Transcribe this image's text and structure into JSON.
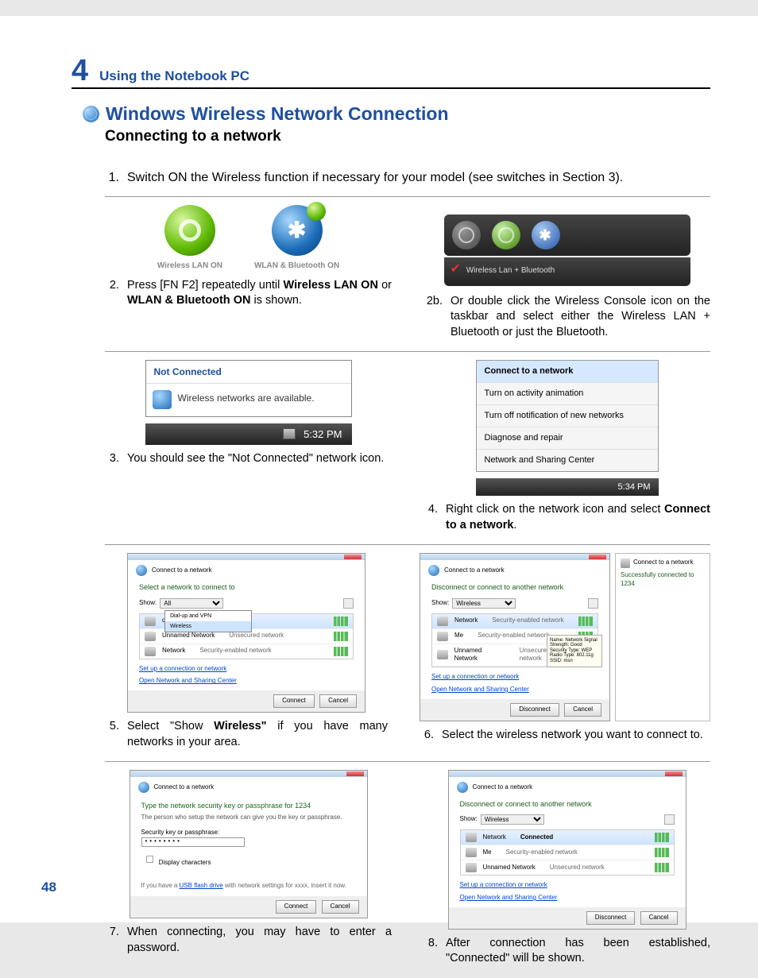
{
  "chapter": {
    "num": "4",
    "title": "Using the Notebook PC"
  },
  "section": {
    "title": "Windows Wireless Network Connection",
    "subtitle": "Connecting to a network"
  },
  "page_num": "48",
  "step1": {
    "num": "1.",
    "text": "Switch ON the Wireless function if necessary for your model (see switches in Section 3)."
  },
  "step2": {
    "num": "2.",
    "text_pre": "Press [FN F2] repeatedly until ",
    "bold1": "Wireless LAN ON",
    "mid": " or ",
    "bold2": "WLAN & Bluetooth ON",
    "text_post": " is shown.",
    "osd_wlan": "Wireless LAN ON",
    "osd_both": "WLAN & Bluetooth ON"
  },
  "step2b": {
    "num": "2b.",
    "text": "Or double click the Wireless Console icon on the taskbar and select either the Wireless LAN + Bluetooth or just the Bluetooth.",
    "banner_label": "Wireless Lan + Bluetooth"
  },
  "step3": {
    "num": "3.",
    "text": "You should see the \"Not Connected\" network icon.",
    "balloon_title": "Not Connected",
    "balloon_body": "Wireless networks are available.",
    "tray_time": "5:32 PM"
  },
  "step4": {
    "num": "4.",
    "text_pre": "Right click on the network icon and select ",
    "bold": "Connect to a network",
    "text_post": ".",
    "menu": [
      "Connect to a network",
      "Turn on activity animation",
      "Turn off notification of new networks",
      "Diagnose and repair",
      "Network and Sharing Center"
    ],
    "tray_time": "5:34 PM"
  },
  "step5": {
    "num": "5.",
    "text_pre": "Select \"Show ",
    "bold": "Wireless\"",
    "text_post": " if you have many networks in your area.",
    "dialog": {
      "title": "Connect to a network",
      "prompt": "Select a network to connect to",
      "show_label": "Show:",
      "show_value": "All",
      "dropdown_open": "Dial-up and VPN",
      "dropdown_open2": "Wireless",
      "items": [
        {
          "name": "default",
          "type": "Unsecured network"
        },
        {
          "name": "Unnamed Network",
          "type": "Unsecured network"
        },
        {
          "name": "Network",
          "type": "Security-enabled network"
        }
      ],
      "link1": "Set up a connection or network",
      "link2": "Open Network and Sharing Center",
      "btn_connect": "Connect",
      "btn_cancel": "Cancel"
    }
  },
  "step6": {
    "num": "6.",
    "text": "Select the wireless network you want to connect to.",
    "dialog": {
      "title": "Connect to a network",
      "prompt": "Disconnect or connect to another network",
      "show_label": "Show:",
      "show_value": "Wireless",
      "items": [
        {
          "name": "Network",
          "type": "Security-enabled network"
        },
        {
          "name": "Me",
          "type": "Security-enabled network"
        },
        {
          "name": "Unnamed Network",
          "type": "Unsecured network"
        }
      ],
      "tooltip": "Name: Network\nSignal Strength: Good\nSecurity Type: WEP\nRadio Type: 802.11g\nSSID: msn",
      "link1": "Set up a connection or network",
      "link2": "Open Network and Sharing Center",
      "btn_disconnect": "Disconnect",
      "btn_cancel": "Cancel"
    },
    "side": {
      "title": "Connect to a network",
      "msg": "Successfully connected to 1234"
    }
  },
  "step7": {
    "num": "7.",
    "text": "When connecting, you may have to enter a password.",
    "dialog": {
      "title": "Connect to a network",
      "prompt": "Type the network security key or passphrase for 1234",
      "hint": "The person who setup the network can give you the key or passphrase.",
      "field_label": "Security key or passphrase:",
      "value_masked": "••••••••",
      "checkbox": "Display characters",
      "usb_pre": "If you have a ",
      "usb_link": "USB flash drive",
      "usb_post": " with network settings for xxxx, insert it now.",
      "btn_connect": "Connect",
      "btn_cancel": "Cancel"
    }
  },
  "step8": {
    "num": "8.",
    "text": "After connection has been established, \"Connected\" will be shown.",
    "dialog": {
      "title": "Connect to a network",
      "prompt": "Disconnect or connect to another network",
      "show_label": "Show:",
      "show_value": "Wireless",
      "items": [
        {
          "name": "Network",
          "type": "Connected"
        },
        {
          "name": "Me",
          "type": "Security-enabled network"
        },
        {
          "name": "Unnamed Network",
          "type": "Unsecured network"
        }
      ],
      "link1": "Set up a connection or network",
      "link2": "Open Network and Sharing Center",
      "btn_disconnect": "Disconnect",
      "btn_cancel": "Cancel"
    }
  }
}
